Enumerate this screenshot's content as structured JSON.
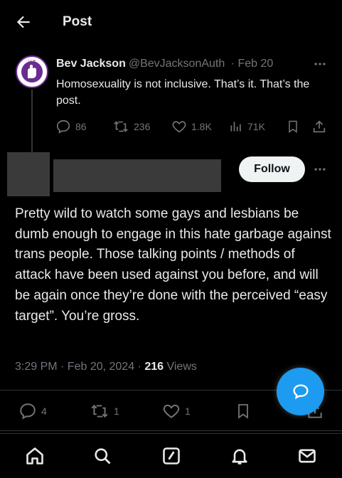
{
  "header": {
    "title": "Post"
  },
  "quoted": {
    "name": "Bev Jackson",
    "handle": "@BevJacksonAuth",
    "date": "· Feb 20",
    "text": "Homosexuality is not inclusive. That’s it. That’s the post.",
    "replies": "86",
    "reposts": "236",
    "likes": "1.8K",
    "views": "71K"
  },
  "reply": {
    "follow_label": "Follow",
    "text": "Pretty wild to watch some gays and lesbians be dumb enough to engage in this hate garbage against trans people. Those talking points / methods of attack have been used against you before, and will be again once they’re done with the perceived “easy target”. You’re gross.",
    "timestamp": "3:29 PM · Feb 20, 2024 · ",
    "views_count": "216",
    "views_label": " Views",
    "replies": "4",
    "reposts": "1",
    "likes": "1"
  },
  "colors": {
    "accent": "#1d9bf0",
    "muted": "#71767b",
    "text": "#e7e9ea",
    "avatar_border": "#6a2c91"
  },
  "icons": [
    "back-arrow-icon",
    "more-icon",
    "reply-icon",
    "repost-icon",
    "like-icon",
    "views-icon",
    "bookmark-icon",
    "share-icon",
    "compose-message-icon",
    "home-icon",
    "search-icon",
    "compose-icon",
    "notifications-icon",
    "messages-icon"
  ]
}
